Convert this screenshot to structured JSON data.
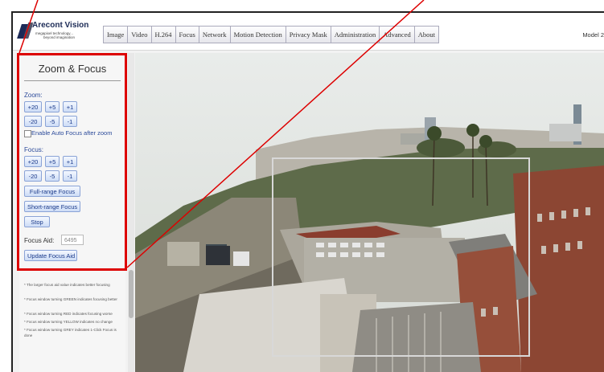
{
  "header": {
    "logo_name": "Arecont Vision",
    "logo_tagline_1": "megapixel technology...",
    "logo_tagline_2": "beyond imagination",
    "model": "Model 2",
    "tabs": [
      "Image",
      "Video",
      "H.264",
      "Focus",
      "Network",
      "Motion Detection",
      "Privacy Mask",
      "Administration",
      "Advanced",
      "About"
    ]
  },
  "panel": {
    "title": "Zoom & Focus",
    "zoom_label": "Zoom:",
    "zoom_plus": [
      "+20",
      "+5",
      "+1"
    ],
    "zoom_minus": [
      "-20",
      "-5",
      "-1"
    ],
    "auto_focus_label": "Enable Auto Focus after zoom",
    "focus_label": "Focus:",
    "focus_plus": [
      "+20",
      "+5",
      "+1"
    ],
    "focus_minus": [
      "-20",
      "-5",
      "-1"
    ],
    "full_range": "Full-range Focus",
    "short_range": "Short-range Focus",
    "stop": "Stop",
    "focus_aid_label": "Focus Aid:",
    "focus_aid_value": "6495",
    "update_focus_aid": "Update Focus Aid",
    "notes": [
      "* The larger focus aid value indicates better focusing",
      "* Focus window turning GREEN indicates focusing better",
      "* Focus window turning RED indicates focusing worse",
      "* Focus window turning YELLOW indicates no change",
      "* Focus window turning GREY indicates 1-Click Focus is done"
    ]
  },
  "colors": {
    "highlight": "#dd0000",
    "button_text": "#1a3a8a",
    "label_blue": "#2b4a9a"
  }
}
